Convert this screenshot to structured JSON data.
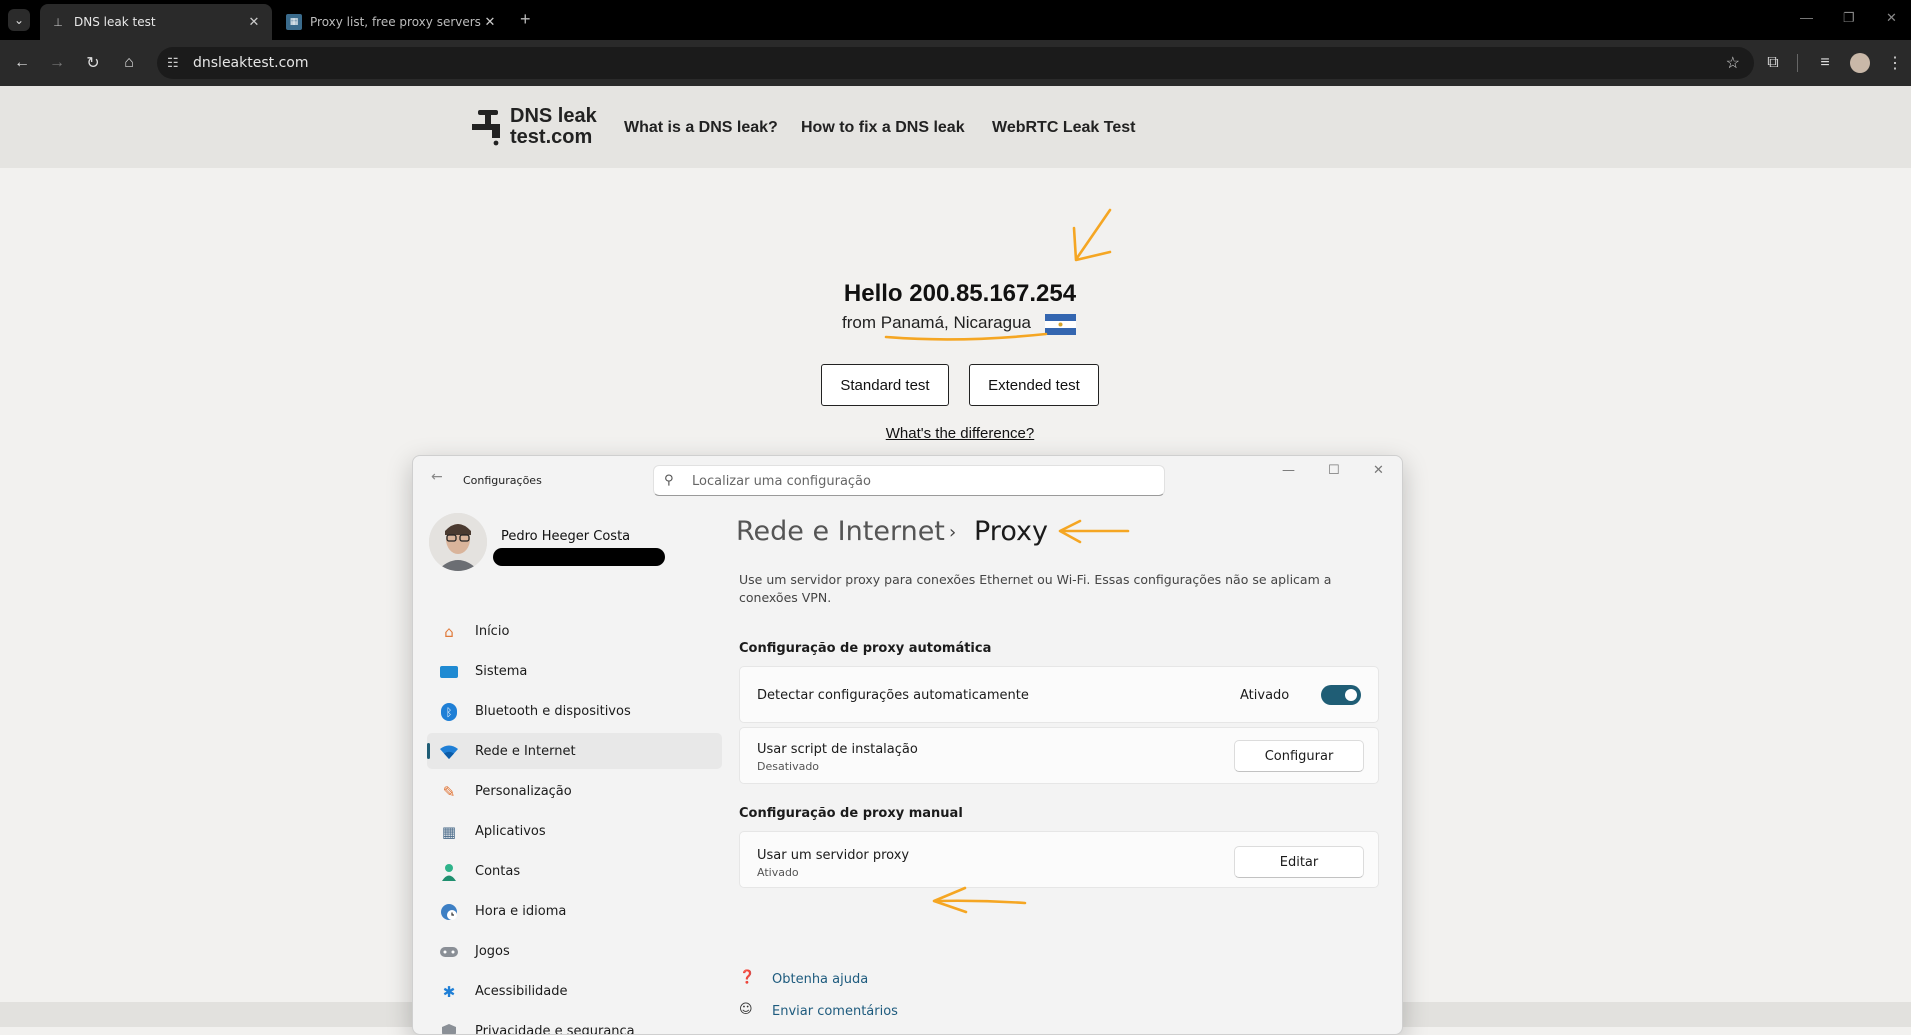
{
  "browser": {
    "tabs": [
      {
        "title": "DNS leak test",
        "active": true
      },
      {
        "title": "Proxy list, free proxy servers list",
        "active": false
      }
    ],
    "new_tab_symbol": "+",
    "close_symbol": "✕",
    "address": "dnsleaktest.com"
  },
  "site": {
    "logo_line1": "DNS leak",
    "logo_line2": "test.com",
    "nav": [
      "What is a DNS leak?",
      "How to fix a DNS leak",
      "WebRTC Leak Test"
    ],
    "hello": "Hello 200.85.167.254",
    "from_prefix": "from",
    "location": "Panamá, Nicaragua",
    "standard_test": "Standard test",
    "extended_test": "Extended test",
    "difference_link": "What's the difference?"
  },
  "settings": {
    "app_title": "Configurações",
    "search_placeholder": "Localizar uma configuração",
    "user_name": "Pedro Heeger Costa",
    "nav": [
      {
        "label": "Início",
        "icon": "home-icon"
      },
      {
        "label": "Sistema",
        "icon": "monitor-icon"
      },
      {
        "label": "Bluetooth e dispositivos",
        "icon": "bluetooth-icon"
      },
      {
        "label": "Rede e Internet",
        "icon": "wifi-icon",
        "selected": true
      },
      {
        "label": "Personalização",
        "icon": "brush-icon"
      },
      {
        "label": "Aplicativos",
        "icon": "apps-icon"
      },
      {
        "label": "Contas",
        "icon": "person-icon"
      },
      {
        "label": "Hora e idioma",
        "icon": "globe-clock-icon"
      },
      {
        "label": "Jogos",
        "icon": "gamepad-icon"
      },
      {
        "label": "Acessibilidade",
        "icon": "accessibility-icon"
      },
      {
        "label": "Privacidade e segurança",
        "icon": "shield-icon"
      }
    ],
    "breadcrumb_parent": "Rede e Internet",
    "breadcrumb_separator": "›",
    "page_title": "Proxy",
    "description": "Use um servidor proxy para conexões Ethernet ou Wi-Fi. Essas configurações não se aplicam a conexões VPN.",
    "auto_section": "Configuração de proxy automática",
    "detect_label": "Detectar configurações automaticamente",
    "detect_status": "Ativado",
    "detect_on": true,
    "script_label": "Usar script de instalação",
    "script_status": "Desativado",
    "script_button": "Configurar",
    "manual_section": "Configuração de proxy manual",
    "proxy_label": "Usar um servidor proxy",
    "proxy_status": "Ativado",
    "proxy_button": "Editar",
    "help_link": "Obtenha ajuda",
    "feedback_link": "Enviar comentários"
  },
  "colors": {
    "accent": "#1f5d75",
    "annotation": "#f5a623",
    "browser_bg": "#000000",
    "toolbar_bg": "#2a2a2a"
  }
}
